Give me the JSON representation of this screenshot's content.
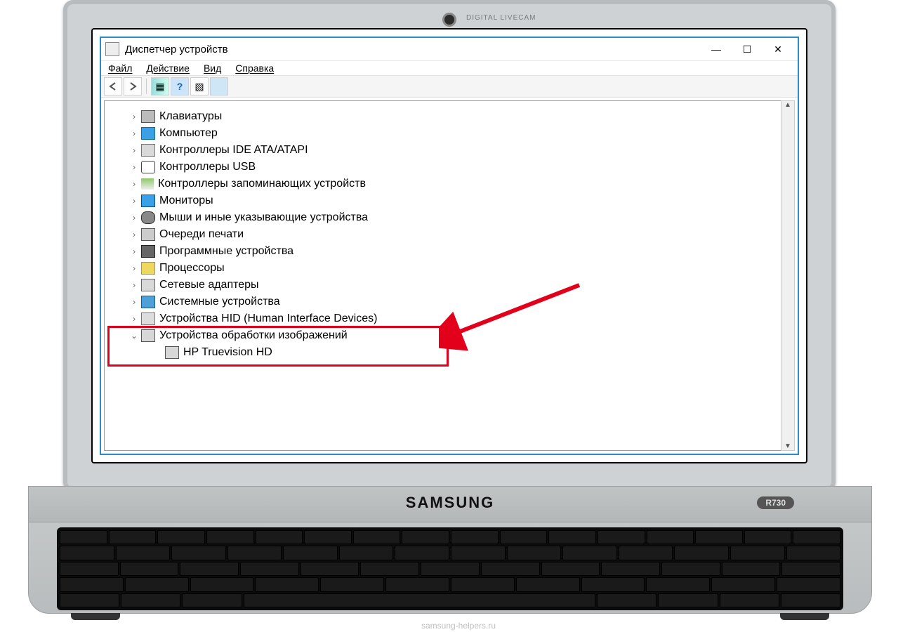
{
  "hardware": {
    "brand": "SAMSUNG",
    "model": "R730",
    "webcam_label": "DIGITAL LIVECAM"
  },
  "watermark": "samsung-helpers.ru",
  "window": {
    "title": "Диспетчер устройств",
    "menu": {
      "file": "Файл",
      "action": "Действие",
      "view": "Вид",
      "help": "Справка"
    }
  },
  "tree": {
    "items": [
      {
        "label": "Клавиатуры",
        "icon": "ic-keyboard",
        "expanded": false,
        "level": 1
      },
      {
        "label": "Компьютер",
        "icon": "ic-monitor",
        "expanded": false,
        "level": 1
      },
      {
        "label": "Контроллеры IDE ATA/ATAPI",
        "icon": "ic-ide",
        "expanded": false,
        "level": 1
      },
      {
        "label": "Контроллеры USB",
        "icon": "ic-usb",
        "expanded": false,
        "level": 1
      },
      {
        "label": "Контроллеры запоминающих устройств",
        "icon": "ic-storage",
        "expanded": false,
        "level": 1
      },
      {
        "label": "Мониторы",
        "icon": "ic-mon",
        "expanded": false,
        "level": 1
      },
      {
        "label": "Мыши и иные указывающие устройства",
        "icon": "ic-mouse",
        "expanded": false,
        "level": 1
      },
      {
        "label": "Очереди печати",
        "icon": "ic-print",
        "expanded": false,
        "level": 1
      },
      {
        "label": "Программные устройства",
        "icon": "ic-prog",
        "expanded": false,
        "level": 1
      },
      {
        "label": "Процессоры",
        "icon": "ic-cpu",
        "expanded": false,
        "level": 1
      },
      {
        "label": "Сетевые адаптеры",
        "icon": "ic-net",
        "expanded": false,
        "level": 1
      },
      {
        "label": "Системные устройства",
        "icon": "ic-sys",
        "expanded": false,
        "level": 1
      },
      {
        "label": "Устройства HID (Human Interface Devices)",
        "icon": "ic-hid",
        "expanded": false,
        "level": 1
      },
      {
        "label": "Устройства обработки изображений",
        "icon": "ic-cam",
        "expanded": true,
        "level": 1
      },
      {
        "label": "HP Truevision HD",
        "icon": "ic-cam",
        "expanded": null,
        "level": 2
      }
    ],
    "highlighted_range": [
      13,
      14
    ]
  }
}
